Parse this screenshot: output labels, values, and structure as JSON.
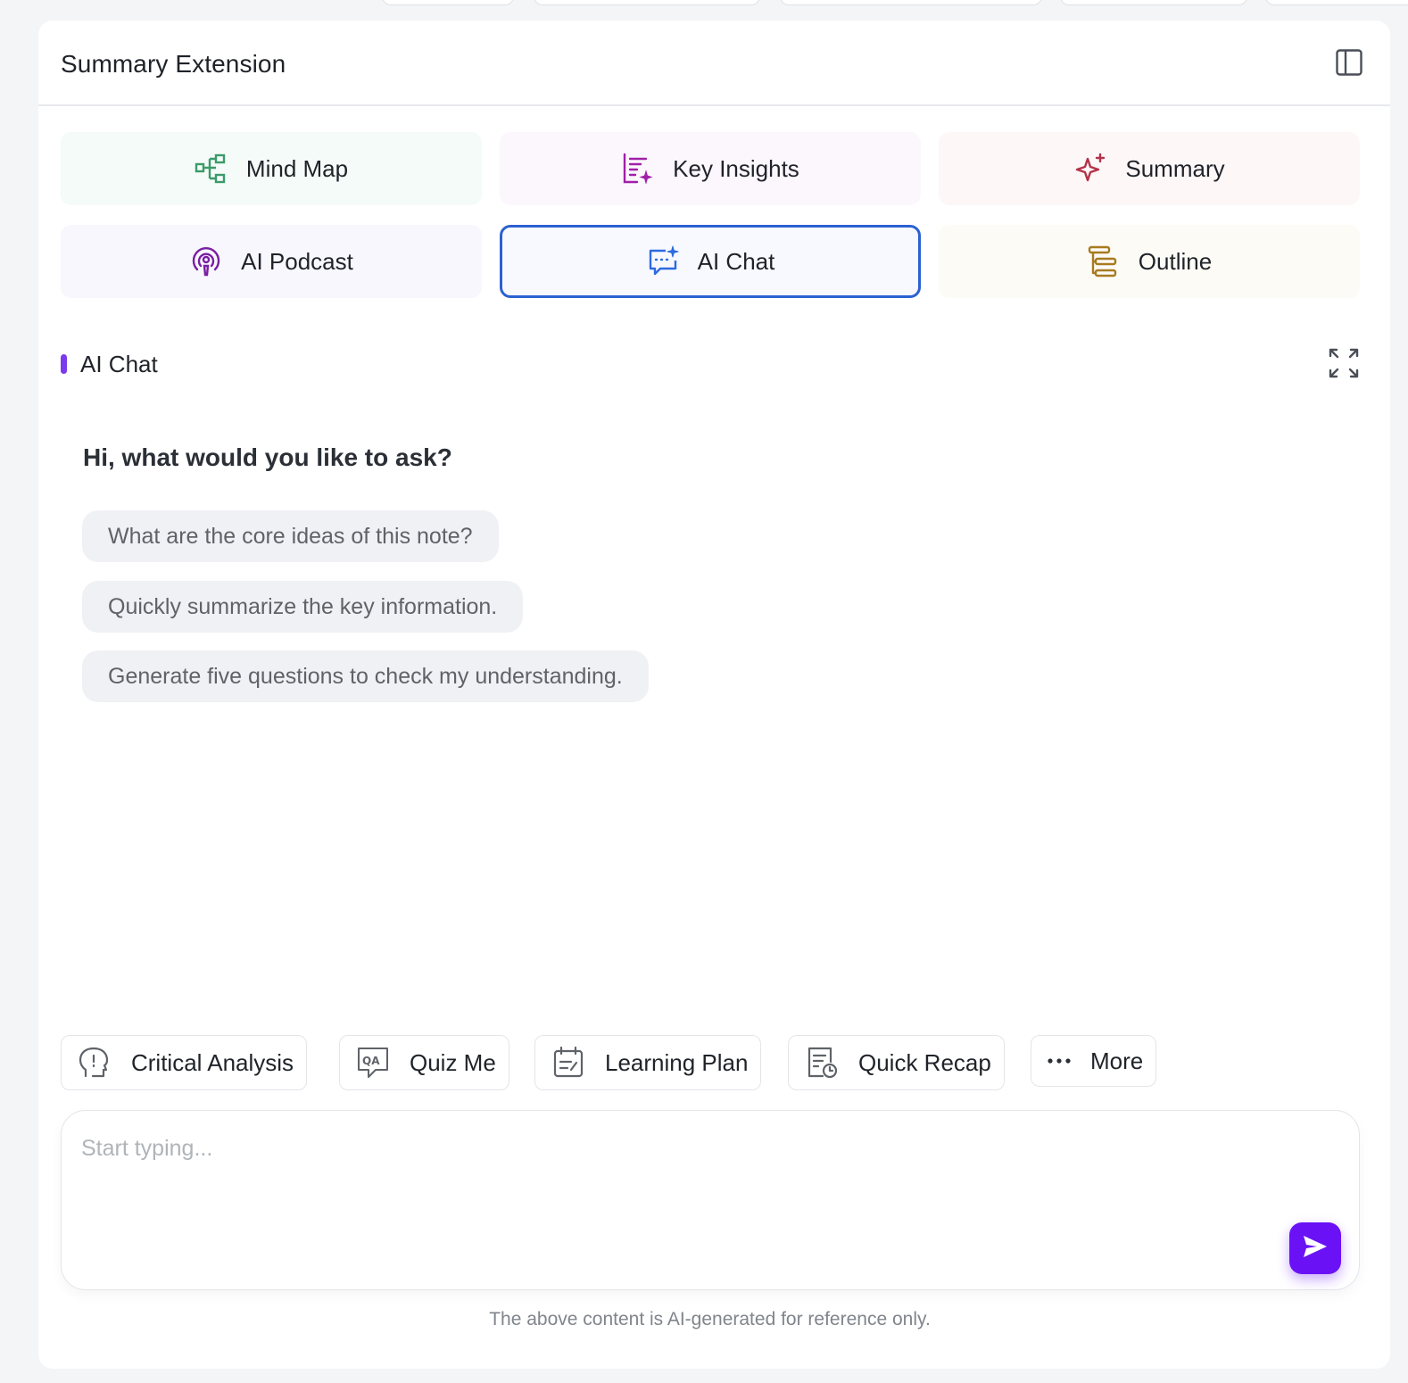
{
  "header": {
    "title": "Summary Extension"
  },
  "tiles": [
    {
      "label": "Mind Map",
      "icon": "mind-map-icon",
      "bg": "#f5fbf8",
      "icon_color": "#3a9b6a"
    },
    {
      "label": "Key Insights",
      "icon": "key-insights-icon",
      "bg": "#fcf7fd",
      "icon_color": "#a020a8"
    },
    {
      "label": "Summary",
      "icon": "sparkle-icon",
      "bg": "#fdf7f8",
      "icon_color": "#b43349"
    },
    {
      "label": "AI Podcast",
      "icon": "podcast-icon",
      "bg": "#f8f7fd",
      "icon_color": "#7a1fa2"
    },
    {
      "label": "AI Chat",
      "icon": "ai-chat-icon",
      "bg": "#f8f9fe",
      "icon_color": "#2d6be0",
      "active": true
    },
    {
      "label": "Outline",
      "icon": "outline-icon",
      "bg": "#fdfbf6",
      "icon_color": "#a77b21"
    }
  ],
  "section": {
    "title": "AI Chat",
    "accent": "#7c3aed"
  },
  "chat": {
    "greeting": "Hi, what would you like to ask?",
    "suggestions": [
      "What are the core ideas of this note?",
      "Quickly summarize the key information.",
      "Generate five questions to check my understanding."
    ]
  },
  "quick_actions": [
    {
      "label": "Critical Analysis",
      "icon": "brain-head-icon"
    },
    {
      "label": "Quiz Me",
      "icon": "qa-icon"
    },
    {
      "label": "Learning Plan",
      "icon": "calendar-plan-icon"
    },
    {
      "label": "Quick Recap",
      "icon": "recap-doc-icon"
    },
    {
      "label": "More",
      "icon": "more-dots-icon"
    }
  ],
  "input": {
    "placeholder": "Start typing...",
    "value": ""
  },
  "send_color": "#6a12f5",
  "disclaimer": "The above content is AI-generated for reference only."
}
